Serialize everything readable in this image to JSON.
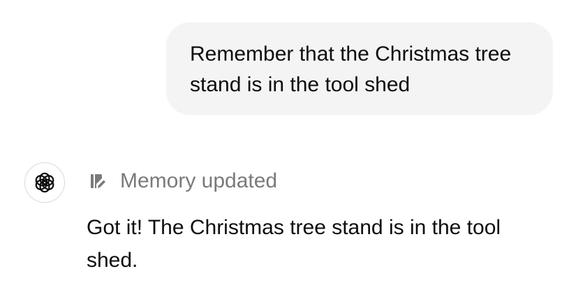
{
  "conversation": {
    "user_message": "Remember that the Christmas tree stand is in the tool shed",
    "assistant": {
      "avatar_icon": "openai-logo-icon",
      "memory_status_icon": "memory-edit-icon",
      "memory_status": "Memory updated",
      "reply": "Got it! The Christmas tree stand is in the tool shed."
    }
  },
  "colors": {
    "user_bubble_bg": "#f4f4f4",
    "text_primary": "#0d0d0d",
    "text_muted": "#7a7a7a",
    "avatar_border": "#d9d9d9"
  }
}
